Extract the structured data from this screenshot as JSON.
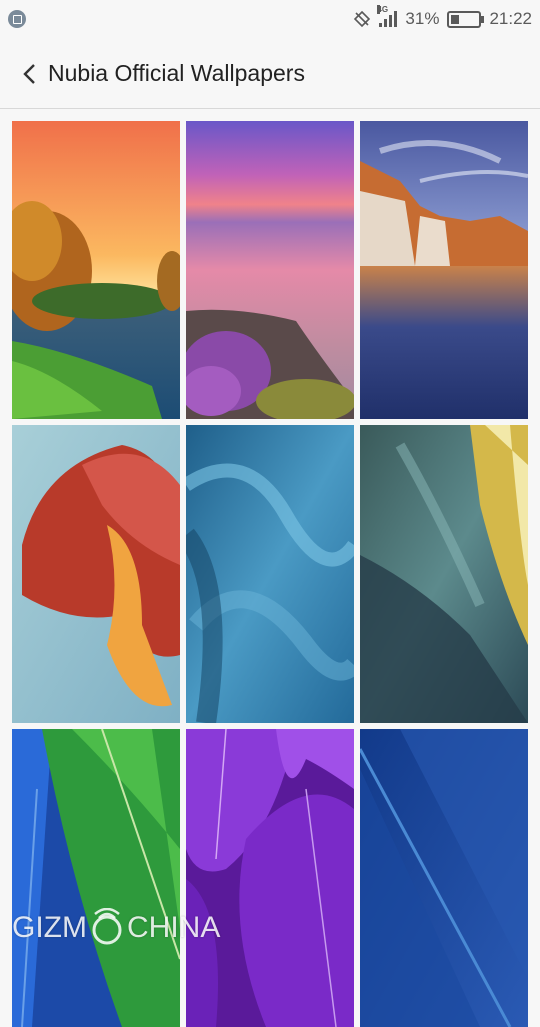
{
  "status_bar": {
    "network": "4G",
    "battery_percent": "31%",
    "battery_level": 0.31,
    "time": "21:22"
  },
  "app_bar": {
    "title": "Nubia Official Wallpapers"
  },
  "wallpapers": [
    {
      "name": "wallpaper-sunset-lake"
    },
    {
      "name": "wallpaper-pink-sea-flowers"
    },
    {
      "name": "wallpaper-red-cliffs-reflection"
    },
    {
      "name": "wallpaper-red-petal-abstract"
    },
    {
      "name": "wallpaper-blue-silk"
    },
    {
      "name": "wallpaper-teal-abstract"
    },
    {
      "name": "wallpaper-green-blue-feathers"
    },
    {
      "name": "wallpaper-purple-feathers"
    },
    {
      "name": "wallpaper-navy-feather"
    }
  ],
  "watermark": {
    "left": "GIZM",
    "right": "CHINA"
  }
}
